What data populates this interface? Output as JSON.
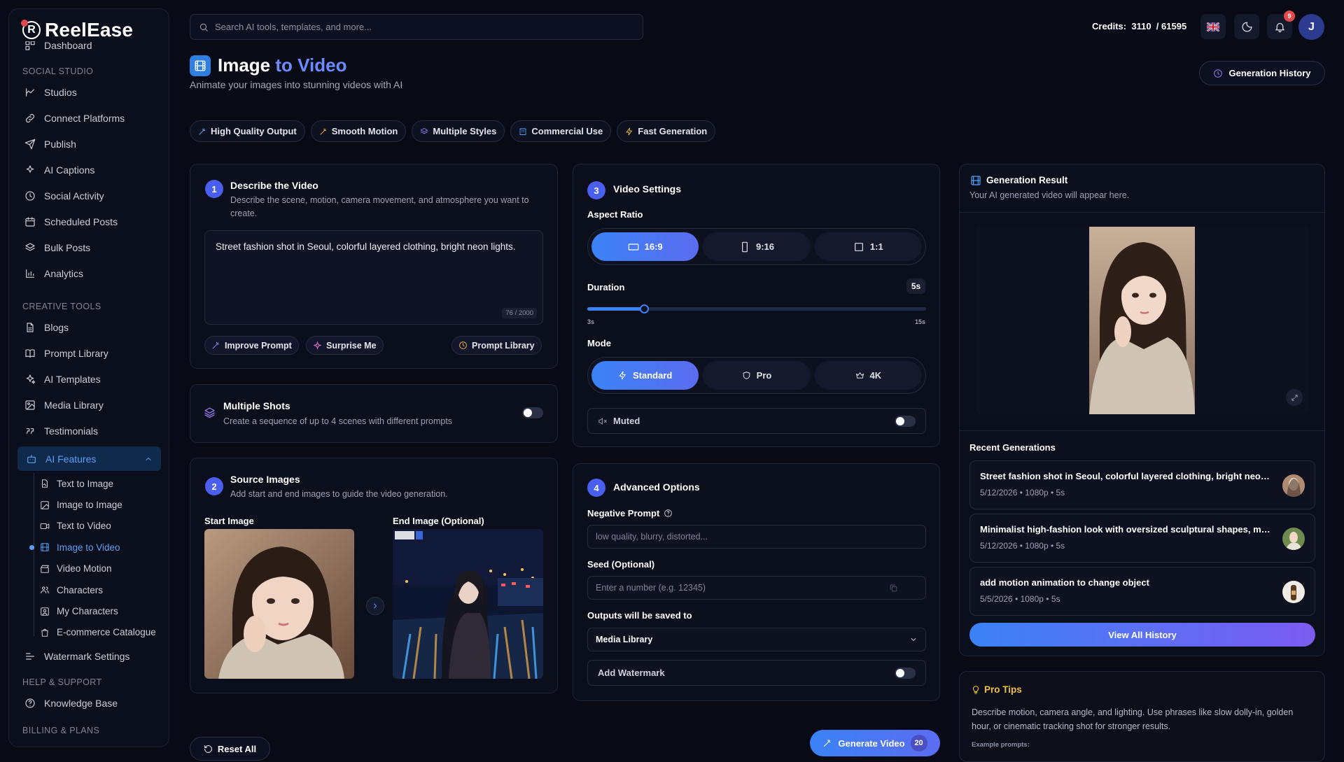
{
  "app": {
    "name": "ReelEase"
  },
  "sidebar": {
    "partial_top": "Dashboard",
    "sections": [
      {
        "title": "SOCIAL STUDIO",
        "items": [
          "Studios",
          "Connect Platforms",
          "Publish",
          "AI Captions",
          "Social Activity",
          "Scheduled Posts",
          "Bulk Posts",
          "Analytics"
        ]
      },
      {
        "title": "CREATIVE TOOLS",
        "items": [
          "Blogs",
          "Prompt Library",
          "AI Templates",
          "Media Library",
          "Testimonials"
        ]
      }
    ],
    "ai_features": {
      "label": "AI Features",
      "children": [
        "Text to Image",
        "Image to Image",
        "Text to Video",
        "Image to Video",
        "Video Motion",
        "Characters",
        "My Characters",
        "E-commerce Catalogue"
      ],
      "active": "Image to Video"
    },
    "watermark": "Watermark Settings",
    "help_title": "HELP & SUPPORT",
    "knowledge": "Knowledge Base",
    "billing_partial": "BILLING & PLANS"
  },
  "topbar": {
    "search_placeholder": "Search AI tools, templates, and more...",
    "credits_label": "Credits:",
    "credits_value": "3110",
    "credits_total": "/ 61595",
    "notif_count": "9",
    "avatar_initial": "J"
  },
  "page": {
    "title_main": "Image",
    "title_accent": "to Video",
    "subtitle": "Animate your images into stunning videos with AI",
    "history_button": "Generation History",
    "chips": [
      "High Quality Output",
      "Smooth Motion",
      "Multiple Styles",
      "Commercial Use",
      "Fast Generation"
    ]
  },
  "describe": {
    "step": "1",
    "title": "Describe the Video",
    "desc": "Describe the scene, motion, camera movement, and atmosphere you want to create.",
    "prompt": "Street fashion shot in Seoul, colorful layered clothing, bright neon lights.",
    "counter": "76 / 2000",
    "improve": "Improve Prompt",
    "surprise": "Surprise Me",
    "library": "Prompt Library"
  },
  "multi": {
    "title": "Multiple Shots",
    "desc": "Create a sequence of up to 4 scenes with different prompts",
    "enabled": false
  },
  "source": {
    "step": "2",
    "title": "Source Images",
    "desc": "Add start and end images to guide the video generation.",
    "start_label": "Start Image",
    "end_label": "End Image (Optional)"
  },
  "settings": {
    "step": "3",
    "title": "Video Settings",
    "aspect_label": "Aspect Ratio",
    "aspects": [
      "16:9",
      "9:16",
      "1:1"
    ],
    "aspect_selected": "16:9",
    "duration_label": "Duration",
    "duration_value": "5s",
    "duration_min": "3s",
    "duration_max": "15s",
    "duration_seconds": 5,
    "mode_label": "Mode",
    "modes": [
      "Standard",
      "Pro",
      "4K"
    ],
    "mode_selected": "Standard",
    "muted_label": "Muted",
    "muted": false
  },
  "advanced": {
    "step": "4",
    "title": "Advanced Options",
    "neg_label": "Negative Prompt",
    "neg_placeholder": "low quality, blurry, distorted...",
    "seed_label": "Seed (Optional)",
    "seed_placeholder": "Enter a number (e.g. 12345)",
    "save_label": "Outputs will be saved to",
    "save_value": "Media Library",
    "watermark_label": "Add Watermark",
    "watermark": false
  },
  "actions": {
    "reset": "Reset All",
    "generate": "Generate Video",
    "generate_cost": "20"
  },
  "result": {
    "title": "Generation Result",
    "desc": "Your AI generated video will appear here.",
    "recent_title": "Recent Generations",
    "items": [
      {
        "title": "Street fashion shot in Seoul, colorful layered clothing, bright neon lights.",
        "meta": "5/12/2026 • 1080p • 5s"
      },
      {
        "title": "Minimalist high-fashion look with oversized sculptural shapes, monochrome palette.",
        "meta": "5/12/2026 • 1080p • 5s"
      },
      {
        "title": "add motion animation to change object",
        "meta": "5/5/2026 • 1080p • 5s"
      }
    ],
    "view_all": "View All History"
  },
  "tips": {
    "title": "Pro Tips",
    "body": "Describe motion, camera angle, and lighting. Use phrases like slow dolly-in, golden hour, or cinematic tracking shot for stronger results.",
    "examples_label": "Example prompts:"
  },
  "colors": {
    "accent": "#4a5ff0",
    "primary_blue": "#3b82f6",
    "bg": "#080b16",
    "card": "#0b0f1c"
  }
}
